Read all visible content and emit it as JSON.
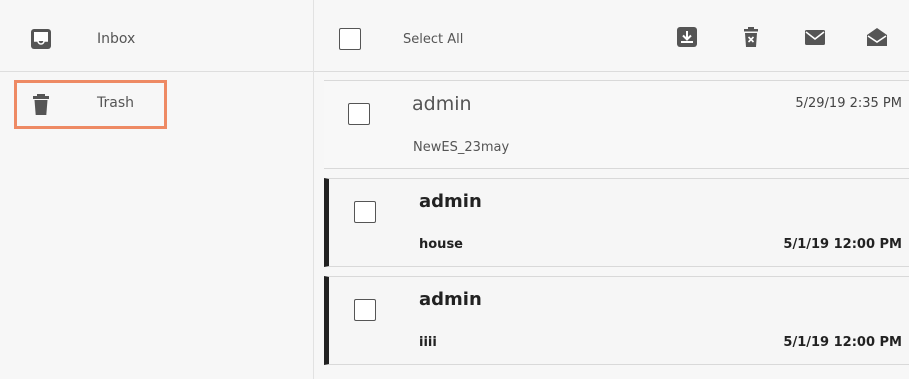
{
  "sidebar": {
    "items": [
      {
        "label": "Inbox",
        "icon": "inbox-icon"
      },
      {
        "label": "Trash",
        "icon": "trash-icon"
      }
    ],
    "highlight_color": "#ee8a64"
  },
  "toolbar": {
    "select_all_label": "Select All",
    "icons": [
      "download-icon",
      "delete-icon",
      "mail-icon",
      "mail-open-icon"
    ]
  },
  "messages": [
    {
      "sender": "admin",
      "subject": "NewES_23may",
      "date": "5/29/19 2:35 PM",
      "unread": false
    },
    {
      "sender": "admin",
      "subject": "house",
      "date": "5/1/19 12:00 PM",
      "unread": true
    },
    {
      "sender": "admin",
      "subject": "iiii",
      "date": "5/1/19 12:00 PM",
      "unread": true
    }
  ]
}
